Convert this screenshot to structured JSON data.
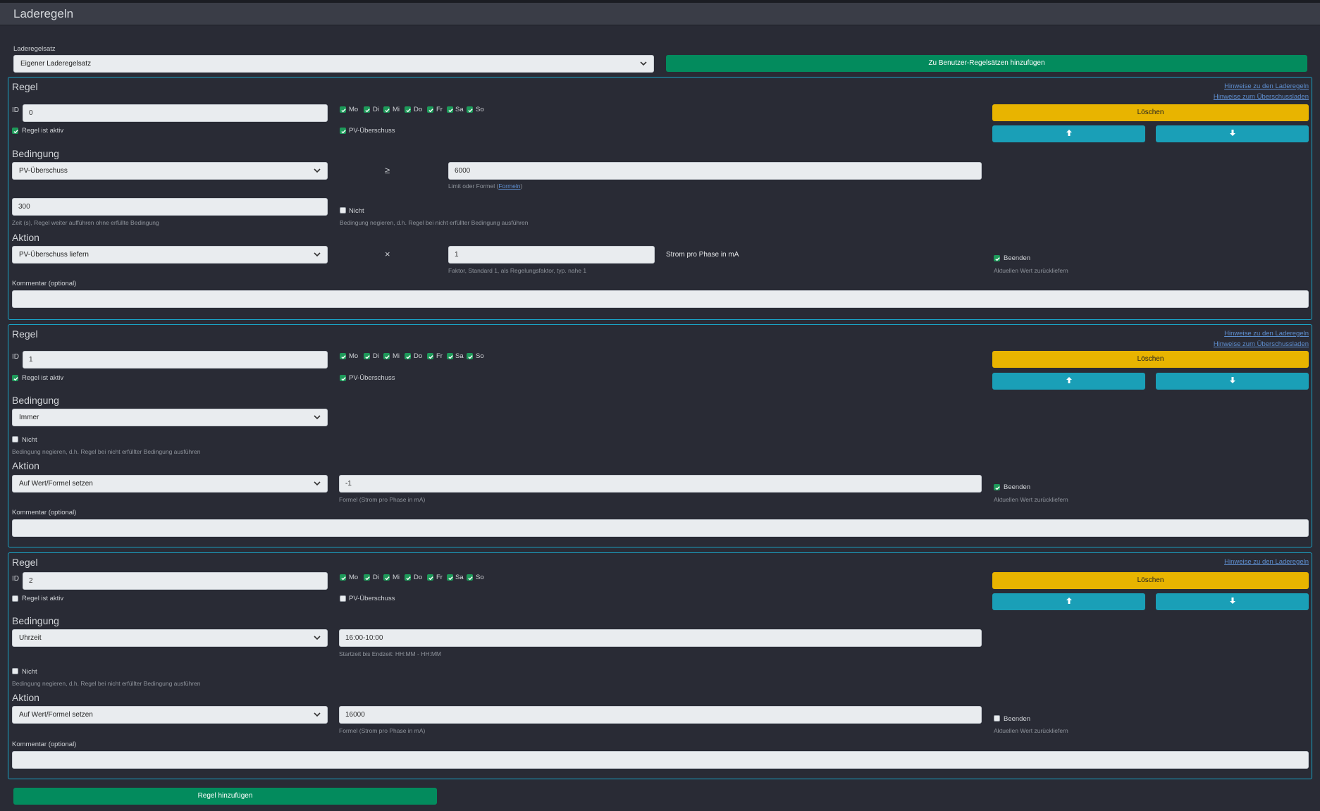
{
  "header": {
    "title": "Laderegeln"
  },
  "ruleset": {
    "label": "Laderegelsatz",
    "selected": "Eigener Laderegelsatz",
    "add_button": "Zu Benutzer-Regelsätzen hinzufügen"
  },
  "common": {
    "rule_heading": "Regel",
    "id_label": "ID",
    "active_label": "Regel ist aktiv",
    "pv_label": "PV-Überschuss",
    "days": [
      "Mo",
      "Di",
      "Mi",
      "Do",
      "Fr",
      "Sa",
      "So"
    ],
    "condition_heading": "Bedingung",
    "action_heading": "Aktion",
    "not_label": "Nicht",
    "not_help": "Bedingung negieren, d.h. Regel bei nicht erfüllter Bedingung ausführen",
    "finish_label": "Beenden",
    "finish_help": "Aktuellen Wert zurückliefern",
    "comment_label": "Kommentar (optional)",
    "delete_button": "Löschen",
    "link_rules": "Hinweise zu den Laderegeln",
    "link_surplus": "Hinweise zum Überschussladen",
    "formula_help": "Formel (Strom pro Phase in mA)"
  },
  "rules": [
    {
      "id": "0",
      "condition": "PV-Überschuss",
      "operator": "≥",
      "limit": "6000",
      "limit_help_prefix": "Limit oder Formel (",
      "limit_help_link": "Formeln",
      "limit_help_suffix": ")",
      "time": "300",
      "time_help": "Zeit (s), Regel weiter aufführen ohne erfüllte Bedingung",
      "action": "PV-Überschuss liefern",
      "action_operator": "×",
      "factor": "1",
      "factor_help": "Faktor, Standard 1, als Regelungsfaktor, typ. nahe 1",
      "factor_unit": "Strom pro Phase in mA",
      "comment": ""
    },
    {
      "id": "1",
      "condition": "Immer",
      "action": "Auf Wert/Formel setzen",
      "value": "-1",
      "comment": ""
    },
    {
      "id": "2",
      "condition": "Uhrzeit",
      "time_range": "16:00-10:00",
      "time_range_help": "Startzeit bis Endzeit: HH:MM - HH:MM",
      "action": "Auf Wert/Formel setzen",
      "value": "16000",
      "comment": ""
    }
  ],
  "footer": {
    "add_rule_button": "Regel hinzufügen"
  }
}
